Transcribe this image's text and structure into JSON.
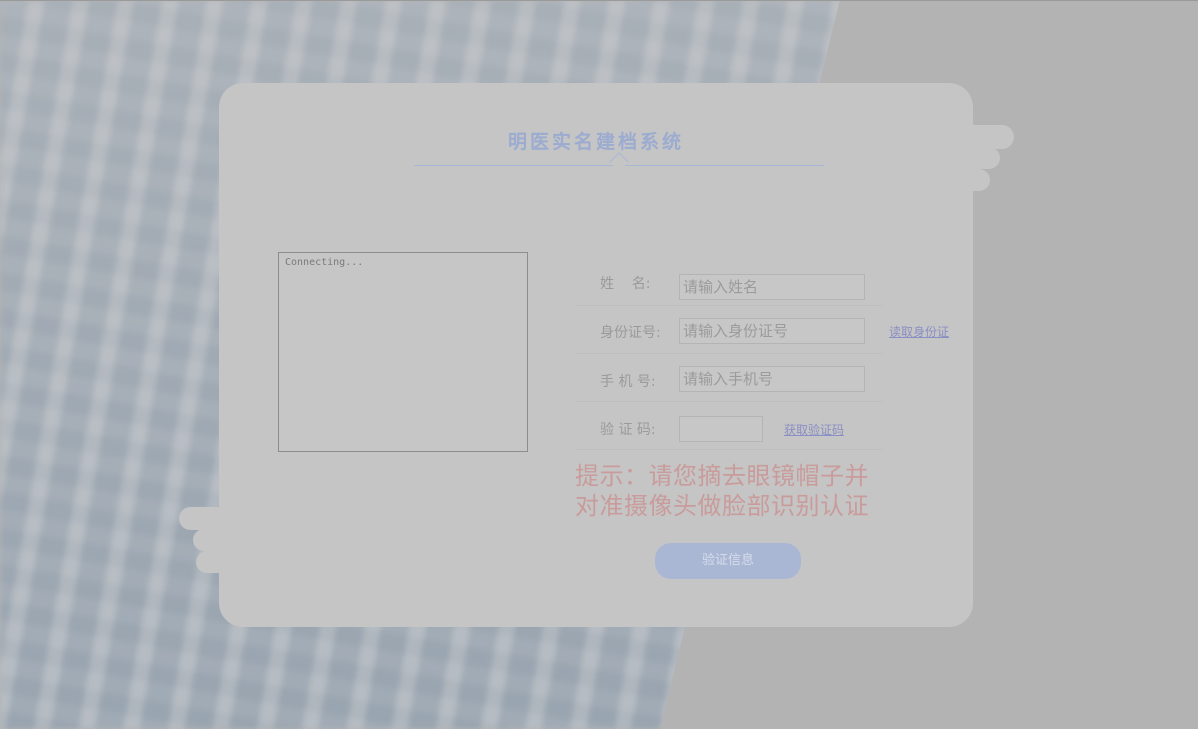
{
  "app": {
    "title": "明医实名建档系统"
  },
  "camera": {
    "status_text": "Connecting..."
  },
  "form": {
    "name": {
      "label": "姓    名:",
      "placeholder": "请输入姓名"
    },
    "id_card": {
      "label": "身份证号:",
      "placeholder": "请输入身份证号",
      "action": "读取身份证"
    },
    "phone": {
      "label": "手 机 号:",
      "placeholder": "请输入手机号"
    },
    "code": {
      "label": "验 证 码:",
      "action": "获取验证码"
    }
  },
  "hint": {
    "line1": "提示：请您摘去眼镜帽子并",
    "line2": "对准摄像头做脸部识别认证"
  },
  "verify_button": {
    "label": "验证信息"
  },
  "colors": {
    "accent": "#9cabd0",
    "hint": "#c99b9b",
    "button": "#a9b7d4",
    "link": "#8a8fc4"
  }
}
